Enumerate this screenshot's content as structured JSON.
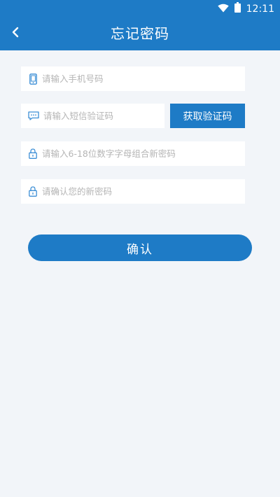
{
  "status_bar": {
    "time": "12:11"
  },
  "app_bar": {
    "title": "忘记密码"
  },
  "form": {
    "phone_placeholder": "请输入手机号码",
    "sms_code_placeholder": "请输入短信验证码",
    "get_code_label": "获取验证码",
    "new_password_placeholder": "请输入6-18位数字字母组合新密码",
    "confirm_password_placeholder": "请确认您的新密码",
    "confirm_label": "确认"
  },
  "colors": {
    "primary": "#1e7bc6",
    "background": "#f2f5f9",
    "field_bg": "#ffffff",
    "icon": "#3d8fd6"
  }
}
